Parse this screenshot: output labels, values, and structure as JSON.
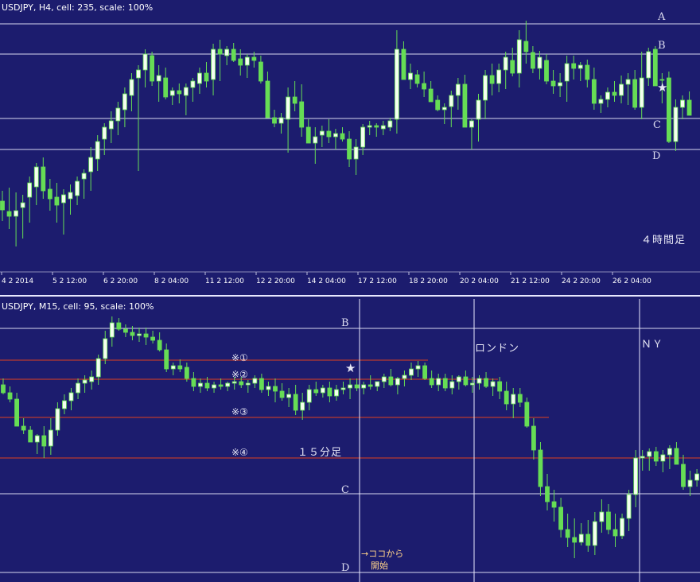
{
  "colors": {
    "background": "#1c1c6e",
    "level_line": "#d8d8f0",
    "red_line": "#e0401e",
    "bull_body": "#f4fff0",
    "bear_body": "#66dd55",
    "wick": "#66dd55",
    "separator": "#e8e8ff",
    "note": "#ffd38a"
  },
  "top_panel": {
    "info": "USDJPY, H4, cell: 235, scale: 100%",
    "timeframe_label": "４時間足",
    "levels": [
      "A",
      "B",
      "C",
      "D"
    ],
    "star": "★",
    "x_ticks": [
      "4 2 2014",
      "5 2 12:00",
      "6 2 20:00",
      "8 2 04:00",
      "11 2 12:00",
      "12 2 20:00",
      "14 2 04:00",
      "17 2 12:00",
      "18 2 20:00",
      "20 2 04:00",
      "21 2 12:00",
      "24 2 20:00",
      "26 2 04:00"
    ]
  },
  "bottom_panel": {
    "info": "USDJPY, M15, cell: 95, scale: 100%",
    "timeframe_label": "１５分足",
    "levels": [
      "B",
      "C",
      "D"
    ],
    "star": "★",
    "session_london": "ロンドン",
    "session_ny": "ＮＹ",
    "marks": [
      "※①",
      "※②",
      "※③",
      "※④"
    ],
    "note_line1": "→ココから",
    "note_line2": "開始"
  },
  "chart_data": [
    {
      "type": "candlestick",
      "title": "USDJPY, H4",
      "x_ticks": [
        "4 2 2014",
        "5 2 12:00",
        "6 2 20:00",
        "8 2 04:00",
        "11 2 12:00",
        "12 2 20:00",
        "14 2 04:00",
        "17 2 12:00",
        "18 2 20:00",
        "20 2 04:00",
        "21 2 12:00",
        "24 2 20:00",
        "26 2 04:00"
      ],
      "price_scale_shown": false,
      "horizontal_levels": [
        "A",
        "B",
        "C",
        "D"
      ],
      "level_positions_in_panel": [
        20,
        58,
        139,
        178
      ],
      "candles_ohlc_in_panel": [
        [
          243,
          230,
          268,
          254
        ],
        [
          256,
          226,
          278,
          262
        ],
        [
          262,
          232,
          300,
          255
        ],
        [
          251,
          235,
          290,
          245
        ],
        [
          238,
          212,
          270,
          220
        ],
        [
          225,
          195,
          248,
          200
        ],
        [
          200,
          188,
          240,
          230
        ],
        [
          228,
          215,
          255,
          240
        ],
        [
          238,
          220,
          270,
          248
        ],
        [
          245,
          228,
          285,
          235
        ],
        [
          240,
          222,
          260,
          232
        ],
        [
          236,
          212,
          248,
          218
        ],
        [
          215,
          203,
          240,
          208
        ],
        [
          206,
          175,
          230,
          188
        ],
        [
          190,
          160,
          205,
          168
        ],
        [
          165,
          145,
          185,
          150
        ],
        [
          152,
          130,
          170,
          142
        ],
        [
          142,
          118,
          160,
          126
        ],
        [
          128,
          100,
          150,
          108
        ],
        [
          110,
          82,
          130,
          90
        ],
        [
          88,
          72,
          205,
          78
        ],
        [
          78,
          52,
          100,
          58
        ],
        [
          60,
          55,
          98,
          92
        ],
        [
          92,
          72,
          118,
          85
        ],
        [
          88,
          75,
          115,
          112
        ],
        [
          110,
          100,
          122,
          104
        ],
        [
          104,
          95,
          120,
          108
        ],
        [
          110,
          95,
          135,
          100
        ],
        [
          100,
          88,
          118,
          92
        ],
        [
          95,
          75,
          108,
          82
        ],
        [
          82,
          68,
          100,
          92
        ],
        [
          90,
          45,
          110,
          52
        ],
        [
          52,
          40,
          92,
          58
        ],
        [
          60,
          48,
          72,
          52
        ],
        [
          52,
          44,
          68,
          66
        ],
        [
          64,
          52,
          85,
          72
        ],
        [
          72,
          58,
          88,
          62
        ],
        [
          62,
          55,
          75,
          66
        ],
        [
          68,
          60,
          95,
          92
        ],
        [
          92,
          80,
          108,
          138
        ],
        [
          138,
          128,
          150,
          145
        ],
        [
          145,
          132,
          158,
          138
        ],
        [
          140,
          100,
          182,
          112
        ],
        [
          112,
          92,
          130,
          120
        ],
        [
          118,
          96,
          162,
          150
        ],
        [
          150,
          140,
          170,
          170
        ],
        [
          170,
          150,
          196,
          162
        ],
        [
          160,
          148,
          175,
          155
        ],
        [
          155,
          140,
          170,
          162
        ],
        [
          162,
          152,
          178,
          158
        ],
        [
          158,
          150,
          168,
          165
        ],
        [
          165,
          155,
          200,
          190
        ],
        [
          190,
          165,
          210,
          175
        ],
        [
          175,
          146,
          185,
          150
        ],
        [
          150,
          142,
          160,
          148
        ],
        [
          148,
          145,
          162,
          150
        ],
        [
          152,
          142,
          160,
          148
        ],
        [
          150,
          138,
          155,
          142
        ],
        [
          140,
          28,
          158,
          52
        ],
        [
          52,
          42,
          85,
          90
        ],
        [
          90,
          70,
          102,
          82
        ],
        [
          84,
          78,
          100,
          95
        ],
        [
          95,
          80,
          112,
          102
        ],
        [
          102,
          92,
          118,
          118
        ],
        [
          116,
          110,
          130,
          128
        ],
        [
          128,
          120,
          146,
          125
        ],
        [
          124,
          104,
          150,
          110
        ],
        [
          110,
          88,
          128,
          96
        ],
        [
          96,
          84,
          148,
          150
        ],
        [
          150,
          140,
          178,
          142
        ],
        [
          140,
          108,
          168,
          116
        ],
        [
          116,
          78,
          140,
          85
        ],
        [
          85,
          70,
          110,
          95
        ],
        [
          95,
          70,
          106,
          78
        ],
        [
          78,
          55,
          102,
          62
        ],
        [
          66,
          50,
          86,
          82
        ],
        [
          82,
          28,
          100,
          40
        ],
        [
          42,
          16,
          70,
          55
        ],
        [
          56,
          48,
          82,
          76
        ],
        [
          76,
          54,
          90,
          62
        ],
        [
          66,
          58,
          96,
          92
        ],
        [
          92,
          78,
          108,
          98
        ],
        [
          98,
          82,
          112,
          94
        ],
        [
          92,
          60,
          118,
          70
        ],
        [
          70,
          60,
          90,
          76
        ],
        [
          76,
          68,
          92,
          72
        ],
        [
          72,
          65,
          100,
          90
        ],
        [
          90,
          75,
          128,
          120
        ],
        [
          120,
          110,
          132,
          115
        ],
        [
          115,
          100,
          125,
          106
        ],
        [
          106,
          92,
          118,
          110
        ],
        [
          110,
          85,
          120,
          96
        ],
        [
          96,
          82,
          122,
          90
        ],
        [
          90,
          78,
          128,
          125
        ],
        [
          125,
          55,
          140,
          88
        ],
        [
          88,
          50,
          98,
          55
        ],
        [
          52,
          48,
          80,
          98
        ],
        [
          90,
          82,
          120,
          90
        ],
        [
          88,
          80,
          170,
          168
        ],
        [
          168,
          115,
          180,
          125
        ],
        [
          125,
          110,
          140,
          116
        ],
        [
          116,
          105,
          130,
          135
        ]
      ]
    },
    {
      "type": "candlestick",
      "title": "USDJPY, M15",
      "price_scale_shown": false,
      "horizontal_levels": [
        "B",
        "C",
        "D"
      ],
      "marked_levels": [
        "※①",
        "※②",
        "※③",
        "※④"
      ],
      "sessions": [
        "ロンドン",
        "ＮＹ"
      ],
      "annotation": "→ココから 開始",
      "candles_ohlc_in_panel": [
        [
          108,
          100,
          120,
          118
        ],
        [
          118,
          110,
          130,
          126
        ],
        [
          126,
          118,
          150,
          160
        ],
        [
          160,
          150,
          170,
          165
        ],
        [
          165,
          160,
          180,
          180
        ],
        [
          180,
          170,
          195,
          172
        ],
        [
          172,
          160,
          200,
          185
        ],
        [
          185,
          150,
          196,
          165
        ],
        [
          165,
          130,
          172,
          138
        ],
        [
          138,
          120,
          145,
          128
        ],
        [
          128,
          112,
          140,
          118
        ],
        [
          118,
          100,
          126,
          106
        ],
        [
          106,
          96,
          118,
          102
        ],
        [
          104,
          90,
          114,
          98
        ],
        [
          98,
          70,
          108,
          75
        ],
        [
          75,
          40,
          82,
          50
        ],
        [
          48,
          22,
          60,
          30
        ],
        [
          30,
          24,
          40,
          38
        ],
        [
          38,
          32,
          48,
          42
        ],
        [
          42,
          34,
          52,
          46
        ],
        [
          46,
          36,
          54,
          44
        ],
        [
          44,
          36,
          58,
          48
        ],
        [
          48,
          40,
          56,
          52
        ],
        [
          52,
          42,
          66,
          64
        ],
        [
          64,
          56,
          92,
          88
        ],
        [
          88,
          80,
          96,
          84
        ],
        [
          84,
          76,
          92,
          88
        ],
        [
          86,
          80,
          104,
          100
        ],
        [
          100,
          92,
          116,
          110
        ],
        [
          110,
          100,
          118,
          106
        ],
        [
          106,
          98,
          116,
          112
        ],
        [
          112,
          104,
          118,
          108
        ],
        [
          108,
          100,
          114,
          110
        ],
        [
          110,
          104,
          116,
          106
        ],
        [
          106,
          98,
          114,
          104
        ],
        [
          104,
          98,
          112,
          108
        ],
        [
          108,
          102,
          118,
          106
        ],
        [
          106,
          96,
          112,
          100
        ],
        [
          100,
          94,
          118,
          114
        ],
        [
          114,
          104,
          122,
          110
        ],
        [
          110,
          100,
          130,
          116
        ],
        [
          116,
          106,
          128,
          124
        ],
        [
          124,
          112,
          136,
          120
        ],
        [
          120,
          108,
          146,
          140
        ],
        [
          140,
          118,
          152,
          130
        ],
        [
          130,
          108,
          140,
          114
        ],
        [
          114,
          104,
          122,
          118
        ],
        [
          118,
          108,
          124,
          112
        ],
        [
          112,
          104,
          130,
          122
        ],
        [
          122,
          108,
          128,
          114
        ],
        [
          114,
          104,
          120,
          112
        ],
        [
          112,
          100,
          126,
          108
        ],
        [
          108,
          100,
          116,
          112
        ],
        [
          112,
          104,
          120,
          108
        ],
        [
          108,
          96,
          114,
          110
        ],
        [
          110,
          104,
          116,
          104
        ],
        [
          104,
          94,
          112,
          98
        ],
        [
          98,
          88,
          110,
          108
        ],
        [
          108,
          98,
          120,
          100
        ],
        [
          100,
          90,
          110,
          96
        ],
        [
          96,
          80,
          102,
          88
        ],
        [
          88,
          78,
          98,
          84
        ],
        [
          84,
          80,
          102,
          100
        ],
        [
          100,
          90,
          112,
          108
        ],
        [
          108,
          94,
          116,
          100
        ],
        [
          100,
          94,
          116,
          112
        ],
        [
          112,
          96,
          120,
          104
        ],
        [
          104,
          96,
          114,
          98
        ],
        [
          98,
          90,
          110,
          108
        ],
        [
          108,
          98,
          118,
          106
        ],
        [
          106,
          96,
          114,
          100
        ],
        [
          100,
          92,
          112,
          110
        ],
        [
          110,
          100,
          122,
          104
        ],
        [
          104,
          98,
          126,
          116
        ],
        [
          116,
          104,
          140,
          132
        ],
        [
          132,
          112,
          150,
          120
        ],
        [
          120,
          112,
          136,
          130
        ],
        [
          130,
          124,
          162,
          160
        ],
        [
          160,
          150,
          202,
          190
        ],
        [
          190,
          180,
          248,
          236
        ],
        [
          236,
          220,
          266,
          255
        ],
        [
          255,
          240,
          280,
          262
        ],
        [
          262,
          250,
          300,
          290
        ],
        [
          290,
          270,
          312,
          300
        ],
        [
          300,
          276,
          326,
          306
        ],
        [
          306,
          282,
          310,
          296
        ],
        [
          296,
          278,
          318,
          310
        ],
        [
          310,
          268,
          322,
          280
        ],
        [
          280,
          252,
          294,
          268
        ],
        [
          268,
          258,
          296,
          290
        ],
        [
          290,
          270,
          312,
          298
        ],
        [
          298,
          270,
          302,
          276
        ],
        [
          276,
          240,
          292,
          246
        ],
        [
          246,
          190,
          262,
          200
        ],
        [
          200,
          190,
          216,
          198
        ],
        [
          198,
          188,
          216,
          192
        ],
        [
          192,
          186,
          210,
          204
        ],
        [
          204,
          190,
          218,
          196
        ],
        [
          196,
          184,
          214,
          188
        ],
        [
          188,
          180,
          200,
          208
        ],
        [
          208,
          196,
          240,
          236
        ],
        [
          236,
          216,
          248,
          228
        ],
        [
          228,
          214,
          236,
          220
        ],
        [
          220,
          188,
          232,
          202
        ],
        [
          202,
          178,
          214,
          184
        ],
        [
          184,
          170,
          206,
          178
        ],
        [
          178,
          166,
          196,
          188
        ]
      ]
    }
  ]
}
